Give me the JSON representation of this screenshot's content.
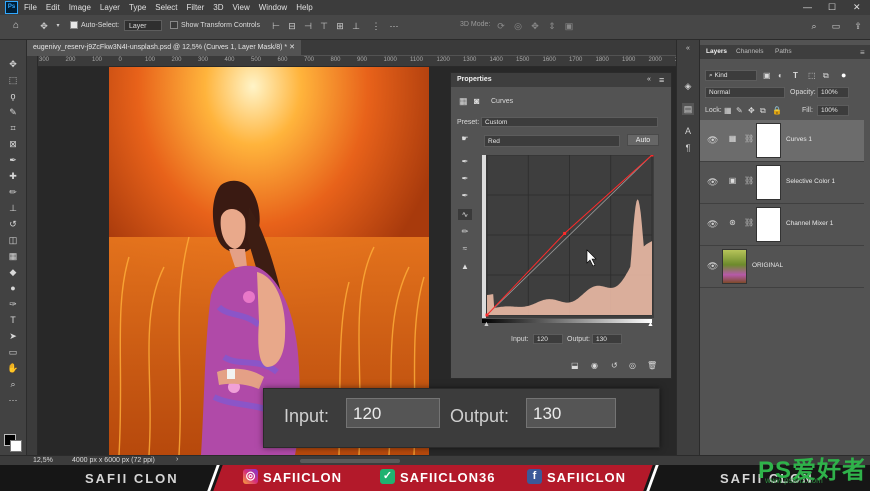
{
  "app": {
    "logo": "Ps"
  },
  "menu": [
    "File",
    "Edit",
    "Image",
    "Layer",
    "Type",
    "Select",
    "Filter",
    "3D",
    "View",
    "Window",
    "Help"
  ],
  "window_controls": {
    "minimize": "—",
    "maximize": "☐",
    "close": "✕"
  },
  "options_bar": {
    "auto_select_label": "Auto-Select:",
    "auto_select_value": "Layer",
    "show_transform_label": "Show Transform Controls",
    "mode_3d_label": "3D Mode:"
  },
  "document": {
    "tab_title": "eugenivy_reserv-j9ZcFkw3N4I-unsplash.psd @ 12,5% (Curves 1, Layer Mask/8) *",
    "ruler_ticks": [
      "300",
      "200",
      "100",
      "0",
      "100",
      "200",
      "300",
      "400",
      "500",
      "600",
      "700",
      "800",
      "900",
      "1000",
      "1100",
      "1200",
      "1300",
      "1400",
      "1500",
      "1600",
      "1700",
      "1800",
      "1900",
      "2000",
      "2100"
    ],
    "zoom": "12,5%",
    "doc_info": "4000 px x 6000 px (72 ppi)"
  },
  "properties": {
    "title": "Properties",
    "panel_name": "Curves",
    "preset_label": "Preset:",
    "preset_value": "Custom",
    "channel_value": "Red",
    "auto_label": "Auto",
    "input_label": "Input:",
    "input_value": "120",
    "output_label": "Output:",
    "output_value": "130"
  },
  "zoom_overlay": {
    "input_label": "Input:",
    "input_value": "120",
    "output_label": "Output:",
    "output_value": "130"
  },
  "layers_panel": {
    "tabs": [
      "Layers",
      "Channels",
      "Paths"
    ],
    "filter_value": "Kind",
    "blend_mode": "Normal",
    "opacity_label": "Opacity:",
    "opacity_value": "100%",
    "lock_label": "Lock:",
    "fill_label": "Fill:",
    "fill_value": "100%",
    "layers": [
      {
        "name": "Curves 1",
        "icon": "curves-icon",
        "selected": true
      },
      {
        "name": "Selective Color 1",
        "icon": "selective-color-icon",
        "selected": false
      },
      {
        "name": "Channel Mixer 1",
        "icon": "channel-mixer-icon",
        "selected": false
      },
      {
        "name": "ORIGINAL",
        "icon": "photo-thumbnail",
        "selected": false
      }
    ]
  },
  "banner": {
    "left_name": "SAFII CLON",
    "right_name": "SAFII CLON",
    "socials": [
      {
        "platform": "instagram",
        "handle": "SAFIICLON"
      },
      {
        "platform": "vine",
        "handle": "SAFIICLON36"
      },
      {
        "platform": "facebook",
        "handle": "SAFIICLON"
      }
    ]
  },
  "watermark": {
    "main": "PS爱好者",
    "sub": "www.psahz.com"
  },
  "chart_data": {
    "type": "line",
    "title": "",
    "channel": "Red",
    "curve_points": [
      [
        0,
        0
      ],
      [
        120,
        130
      ],
      [
        255,
        255
      ]
    ],
    "xlim": [
      0,
      255
    ],
    "ylim": [
      0,
      255
    ]
  }
}
